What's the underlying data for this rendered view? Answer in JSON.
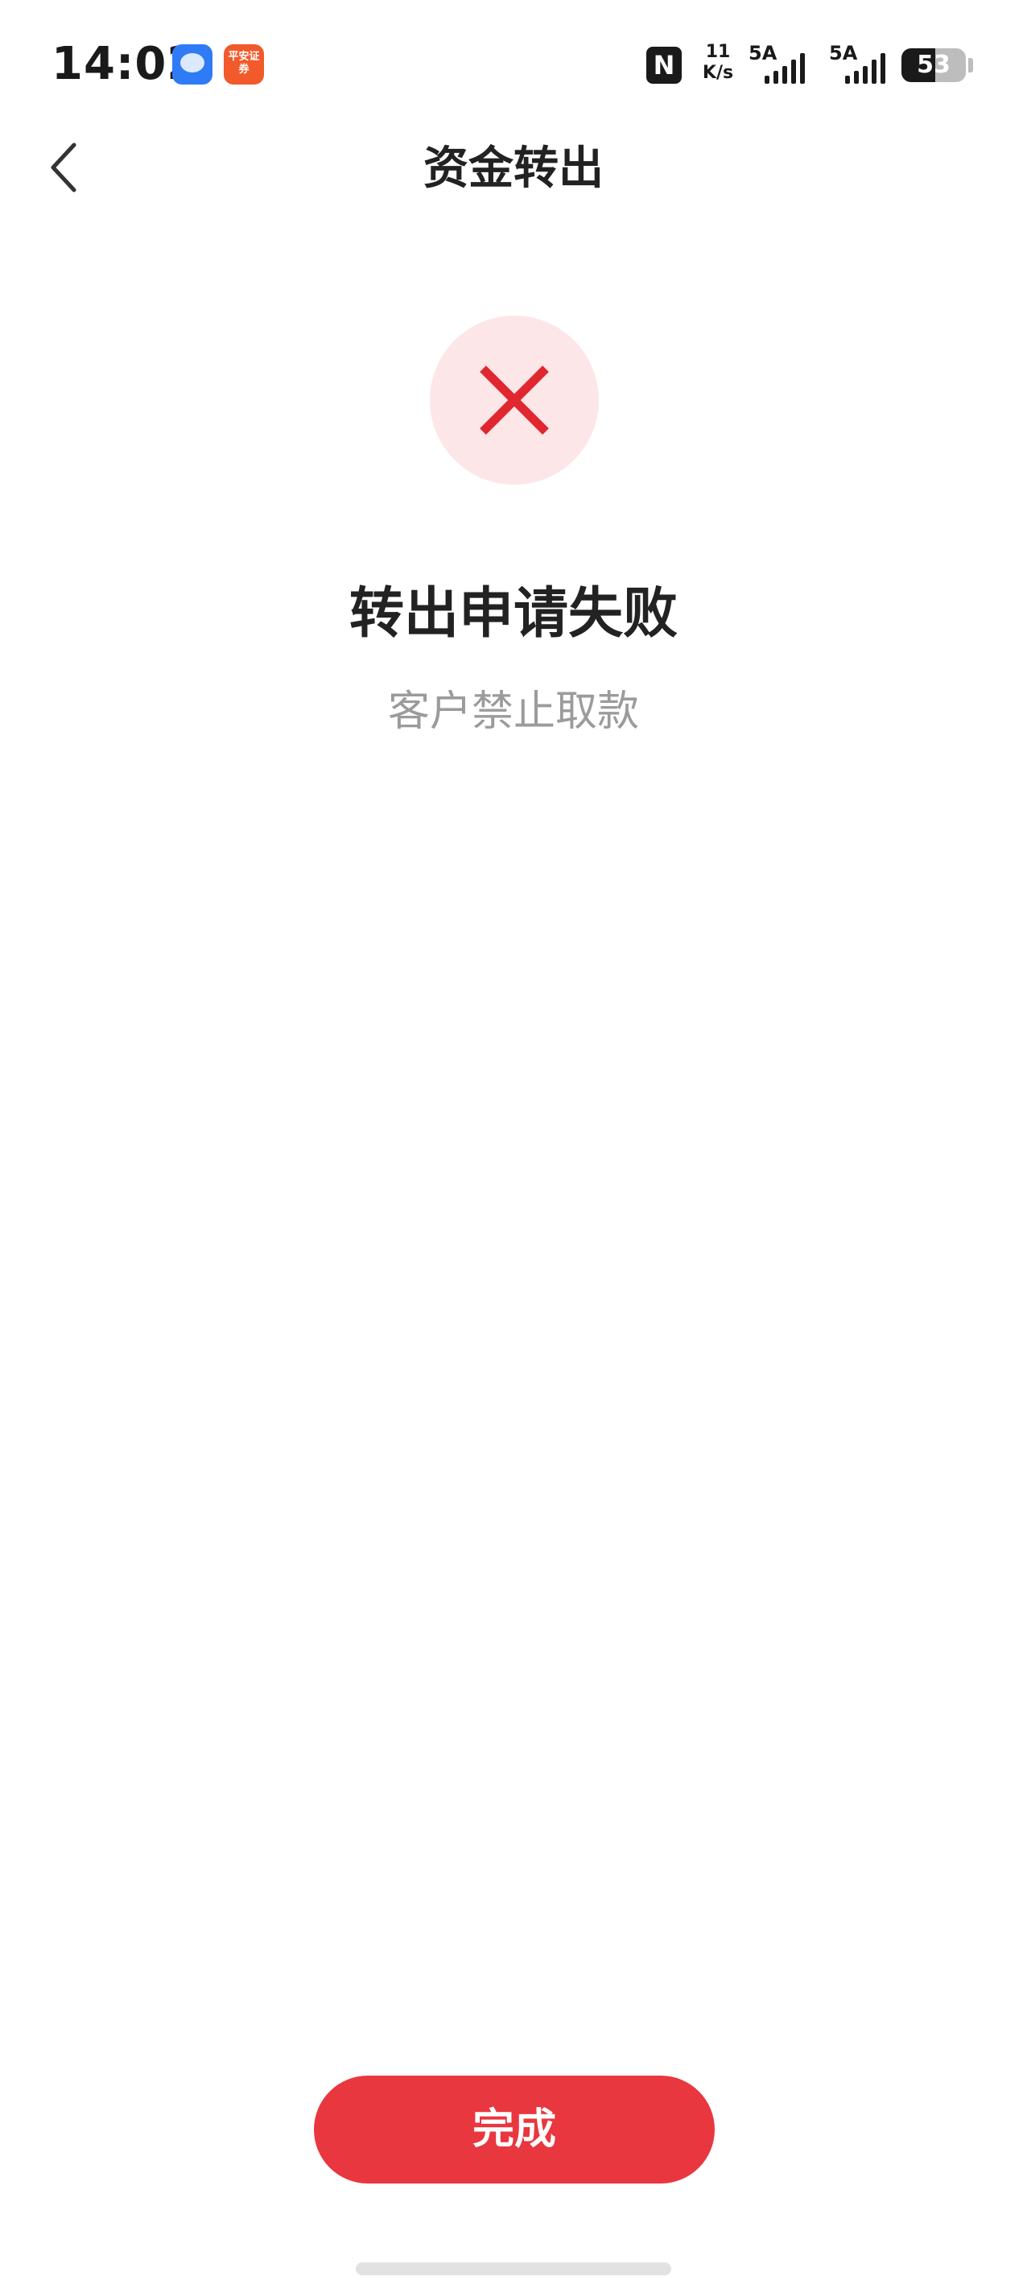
{
  "status_bar": {
    "time": "14:02",
    "pingan_icon_text": "平安证券",
    "nfc_label": "N",
    "net_speed_value": "11",
    "net_speed_unit": "K/s",
    "signal_1_label": "5A",
    "signal_2_label": "5A",
    "battery_level_percent": 53,
    "battery_text": "53"
  },
  "nav": {
    "title": "资金转出"
  },
  "result": {
    "title": "转出申请失败",
    "reason": "客户禁止取款"
  },
  "footer": {
    "done_label": "完成"
  },
  "colors": {
    "accent": "#e9373f",
    "fail_icon": "#e0272f",
    "fail_circle_bg": "#fde6e7",
    "secondary_text": "#9b9b9b"
  },
  "icons": {
    "back": "chevron-left-icon",
    "fail": "close-icon"
  }
}
